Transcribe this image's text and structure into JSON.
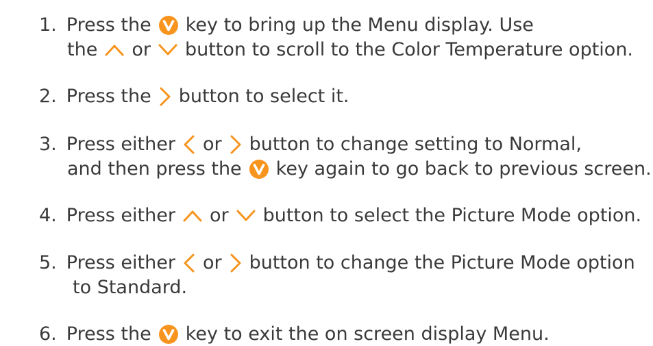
{
  "accent_color": "#f7941d",
  "icons": {
    "menu_key": "menu-v-key-icon",
    "up": "chevron-up-icon",
    "down": "chevron-down-icon",
    "left": "chevron-left-icon",
    "right": "chevron-right-icon"
  },
  "steps": [
    {
      "number": "1.",
      "line1": {
        "a": "Press the",
        "b": "key to bring up the Menu display. Use"
      },
      "line2": {
        "a": "the",
        "b": "or",
        "c": "button to scroll to the Color Temperature option."
      }
    },
    {
      "number": "2.",
      "line1": {
        "a": "Press the",
        "b": "button to select it."
      }
    },
    {
      "number": "3.",
      "line1": {
        "a": "Press either",
        "b": "or",
        "c": "button to change setting to Normal,"
      },
      "line2": {
        "a": "and then press the",
        "b": "key again to go back to previous screen."
      }
    },
    {
      "number": "4.",
      "line1": {
        "a": "Press either",
        "b": "or",
        "c": "button to select the Picture Mode option."
      }
    },
    {
      "number": "5.",
      "line1": {
        "a": "Press either",
        "b": "or",
        "c": "button to change the Picture Mode option"
      },
      "line2": {
        "a": "to Standard."
      }
    },
    {
      "number": "6.",
      "line1": {
        "a": "Press the",
        "b": "key to exit the on screen display Menu."
      }
    }
  ]
}
